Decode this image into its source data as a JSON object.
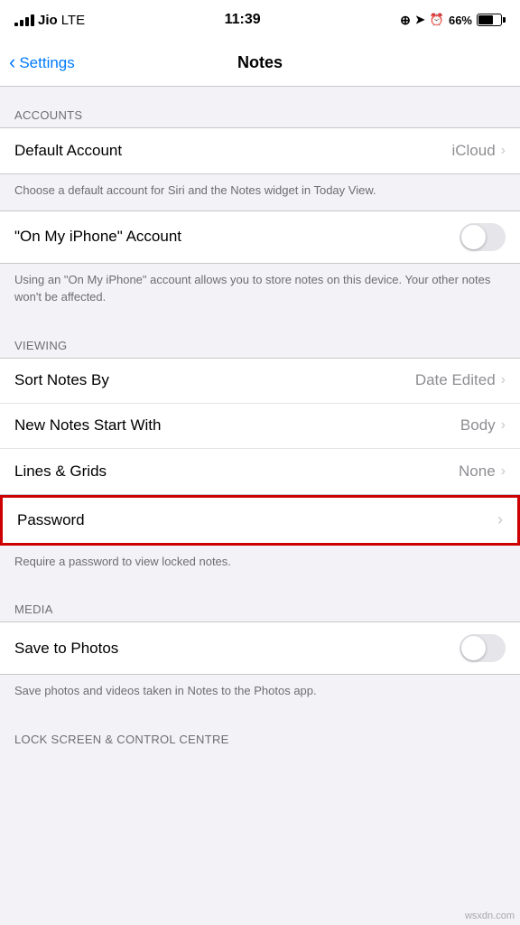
{
  "statusBar": {
    "carrier": "Jio",
    "network": "LTE",
    "time": "11:39",
    "batteryPercent": "66%"
  },
  "navBar": {
    "backLabel": "Settings",
    "title": "Notes"
  },
  "sections": {
    "accounts": {
      "header": "ACCOUNTS",
      "defaultAccount": {
        "label": "Default Account",
        "value": "iCloud"
      },
      "defaultAccountDesc": "Choose a default account for Siri and the Notes widget in Today View.",
      "onMyIphone": {
        "label": "\"On My iPhone\" Account"
      },
      "onMyIphoneDesc": "Using an \"On My iPhone\" account allows you to store notes on this device. Your other notes won't be affected."
    },
    "viewing": {
      "header": "VIEWING",
      "sortNotesBy": {
        "label": "Sort Notes By",
        "value": "Date Edited"
      },
      "newNotesStartWith": {
        "label": "New Notes Start With",
        "value": "Body"
      },
      "linesAndGrids": {
        "label": "Lines & Grids",
        "value": "None"
      },
      "password": {
        "label": "Password"
      },
      "passwordDesc": "Require a password to view locked notes."
    },
    "media": {
      "header": "MEDIA",
      "saveToPhotos": {
        "label": "Save to Photos"
      },
      "saveToPhotosDesc": "Save photos and videos taken in Notes to the Photos app."
    },
    "lockScreen": {
      "header": "LOCK SCREEN & CONTROL CENTRE"
    }
  },
  "icons": {
    "chevron": "›",
    "backChevron": "‹"
  }
}
